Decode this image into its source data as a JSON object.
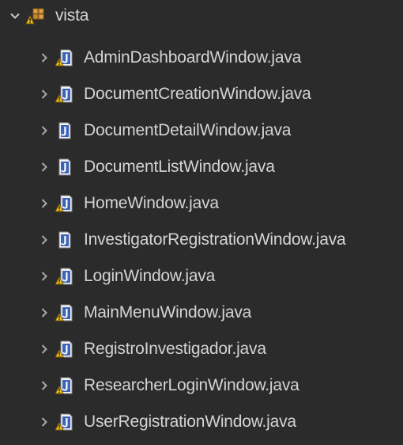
{
  "tree": {
    "folder": {
      "label": "vista",
      "icon": "package-warning-icon",
      "expanded": true
    },
    "files": [
      {
        "label": "AdminDashboardWindow.java",
        "icon": "java-file-warning-icon"
      },
      {
        "label": "DocumentCreationWindow.java",
        "icon": "java-file-warning-icon"
      },
      {
        "label": "DocumentDetailWindow.java",
        "icon": "java-file-icon"
      },
      {
        "label": "DocumentListWindow.java",
        "icon": "java-file-icon"
      },
      {
        "label": "HomeWindow.java",
        "icon": "java-file-warning-icon"
      },
      {
        "label": "InvestigatorRegistrationWindow.java",
        "icon": "java-file-icon"
      },
      {
        "label": "LoginWindow.java",
        "icon": "java-file-warning-icon"
      },
      {
        "label": "MainMenuWindow.java",
        "icon": "java-file-warning-icon"
      },
      {
        "label": "RegistroInvestigador.java",
        "icon": "java-file-warning-icon"
      },
      {
        "label": "ResearcherLoginWindow.java",
        "icon": "java-file-warning-icon"
      },
      {
        "label": "UserRegistrationWindow.java",
        "icon": "java-file-warning-icon"
      }
    ]
  },
  "colors": {
    "background": "#2b2b2b",
    "text": "#d4d4d4",
    "warning": "#e8b530",
    "java_blue": "#3b63b8"
  }
}
